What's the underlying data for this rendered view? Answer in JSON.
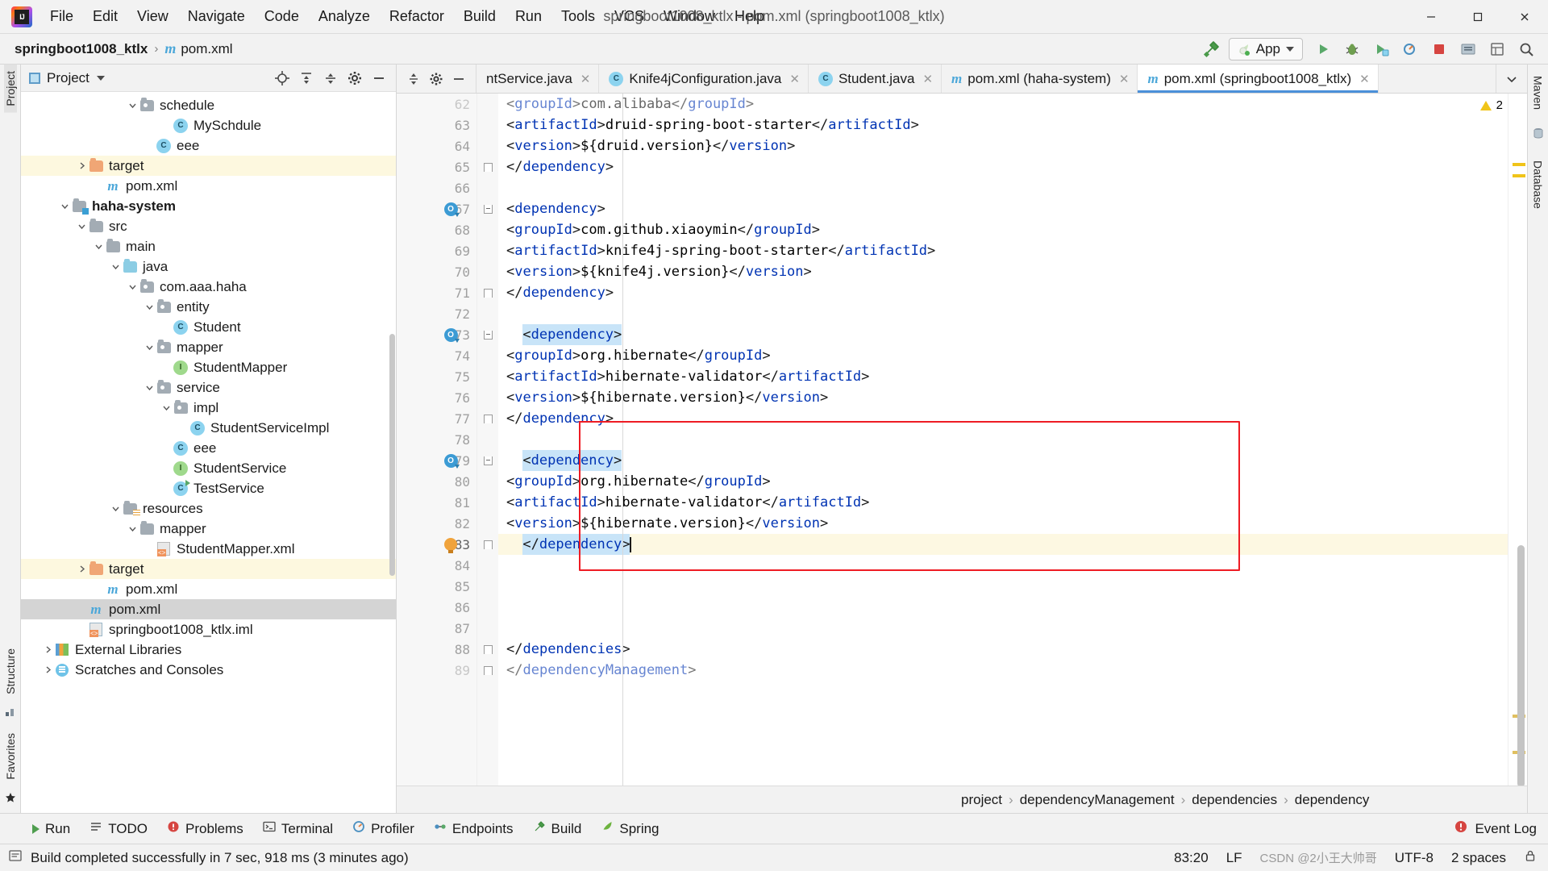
{
  "window": {
    "title": "springboot1008_ktlx - pom.xml (springboot1008_ktlx)",
    "minimize": "—",
    "maximize": "❐",
    "close": "✕",
    "logo_text": "IJ"
  },
  "menubar": {
    "items": [
      {
        "label": "File",
        "mnemonic": "F"
      },
      {
        "label": "Edit",
        "mnemonic": "E"
      },
      {
        "label": "View",
        "mnemonic": "V"
      },
      {
        "label": "Navigate",
        "mnemonic": "N"
      },
      {
        "label": "Code",
        "mnemonic": "C"
      },
      {
        "label": "Analyze",
        "mnemonic": "z"
      },
      {
        "label": "Refactor",
        "mnemonic": "R"
      },
      {
        "label": "Build",
        "mnemonic": "B"
      },
      {
        "label": "Run",
        "mnemonic": "u"
      },
      {
        "label": "Tools",
        "mnemonic": "T"
      },
      {
        "label": "VCS",
        "mnemonic": ""
      },
      {
        "label": "Window",
        "mnemonic": "W"
      },
      {
        "label": "Help",
        "mnemonic": "H"
      }
    ]
  },
  "navbar": {
    "project": "springboot1008_ktlx",
    "separator": "›",
    "file": "pom.xml",
    "run_config": "App",
    "icons": [
      "build-hammer-icon",
      "run-config-selector",
      "run-icon",
      "debug-icon",
      "run-coverage-icon",
      "profiler-icon",
      "stop-icon",
      "update-icon",
      "search-everywhere-icon"
    ]
  },
  "left_rail": {
    "top_label": "Project",
    "bottom_labels": [
      "Structure",
      "Favorites"
    ]
  },
  "right_rail": {
    "labels": [
      "Maven",
      "Database"
    ]
  },
  "project_panel": {
    "title": "Project",
    "actions": [
      "locate-icon",
      "expand-all-icon",
      "collapse-all-icon",
      "settings-gear-icon",
      "hide-icon"
    ],
    "tree": [
      {
        "label": "schedule",
        "indent": 6,
        "arrow": "down",
        "icon": "package-folder",
        "state": "normal"
      },
      {
        "label": "MySchdule",
        "indent": 8,
        "arrow": "none",
        "icon": "class",
        "state": "normal"
      },
      {
        "label": "eee",
        "indent": 7,
        "arrow": "none",
        "icon": "class",
        "state": "normal"
      },
      {
        "label": "target",
        "indent": 3,
        "arrow": "right",
        "icon": "folder-orange",
        "state": "highlight"
      },
      {
        "label": "pom.xml",
        "indent": 4,
        "arrow": "none",
        "icon": "maven",
        "state": "normal"
      },
      {
        "label": "haha-system",
        "indent": 2,
        "arrow": "down",
        "icon": "module-folder",
        "state": "bold"
      },
      {
        "label": "src",
        "indent": 3,
        "arrow": "down",
        "icon": "folder",
        "state": "normal"
      },
      {
        "label": "main",
        "indent": 4,
        "arrow": "down",
        "icon": "folder",
        "state": "normal"
      },
      {
        "label": "java",
        "indent": 5,
        "arrow": "down",
        "icon": "folder-blue",
        "state": "normal"
      },
      {
        "label": "com.aaa.haha",
        "indent": 6,
        "arrow": "down",
        "icon": "package-folder",
        "state": "normal"
      },
      {
        "label": "entity",
        "indent": 7,
        "arrow": "down",
        "icon": "package-folder",
        "state": "normal"
      },
      {
        "label": "Student",
        "indent": 8,
        "arrow": "none",
        "icon": "class",
        "state": "normal"
      },
      {
        "label": "mapper",
        "indent": 7,
        "arrow": "down",
        "icon": "package-folder",
        "state": "normal"
      },
      {
        "label": "StudentMapper",
        "indent": 8,
        "arrow": "none",
        "icon": "interface",
        "state": "normal"
      },
      {
        "label": "service",
        "indent": 7,
        "arrow": "down",
        "icon": "package-folder",
        "state": "normal"
      },
      {
        "label": "impl",
        "indent": 8,
        "arrow": "down",
        "icon": "package-folder",
        "state": "normal"
      },
      {
        "label": "StudentServiceImpl",
        "indent": 9,
        "arrow": "none",
        "icon": "class",
        "state": "normal"
      },
      {
        "label": "eee",
        "indent": 8,
        "arrow": "none",
        "icon": "class",
        "state": "normal"
      },
      {
        "label": "StudentService",
        "indent": 8,
        "arrow": "none",
        "icon": "interface",
        "state": "normal"
      },
      {
        "label": "TestService",
        "indent": 8,
        "arrow": "none",
        "icon": "class-runnable",
        "state": "normal"
      },
      {
        "label": "resources",
        "indent": 5,
        "arrow": "down",
        "icon": "resources-folder",
        "state": "normal"
      },
      {
        "label": "mapper",
        "indent": 6,
        "arrow": "down",
        "icon": "folder",
        "state": "normal"
      },
      {
        "label": "StudentMapper.xml",
        "indent": 7,
        "arrow": "none",
        "icon": "xml-file",
        "state": "normal"
      },
      {
        "label": "target",
        "indent": 3,
        "arrow": "right",
        "icon": "folder-orange",
        "state": "highlight"
      },
      {
        "label": "pom.xml",
        "indent": 4,
        "arrow": "none",
        "icon": "maven",
        "state": "normal"
      },
      {
        "label": "pom.xml",
        "indent": 3,
        "arrow": "none",
        "icon": "maven",
        "state": "selected"
      },
      {
        "label": "springboot1008_ktlx.iml",
        "indent": 3,
        "arrow": "none",
        "icon": "iml-file",
        "state": "normal"
      },
      {
        "label": "External Libraries",
        "indent": 1,
        "arrow": "right",
        "icon": "libraries",
        "state": "normal"
      },
      {
        "label": "Scratches and Consoles",
        "indent": 1,
        "arrow": "right",
        "icon": "scratches",
        "state": "normal"
      }
    ]
  },
  "editor": {
    "tabs": [
      {
        "label": "ntService.java",
        "icon": "none",
        "active": false,
        "closable": true
      },
      {
        "label": "Knife4jConfiguration.java",
        "icon": "class",
        "active": false,
        "closable": true
      },
      {
        "label": "Student.java",
        "icon": "class",
        "active": false,
        "closable": true
      },
      {
        "label": "pom.xml (haha-system)",
        "icon": "maven",
        "active": false,
        "closable": true
      },
      {
        "label": "pom.xml (springboot1008_ktlx)",
        "icon": "maven",
        "active": true,
        "closable": true
      }
    ],
    "tab_tools": [
      "sort-icon",
      "settings-gear-icon",
      "minimize-icon"
    ],
    "inspection_warning_count": "2",
    "lines": [
      {
        "n": "62",
        "text": "      <groupId>com.alibaba</groupId>",
        "clipped": true
      },
      {
        "n": "63",
        "text": "      <artifactId>druid-spring-boot-starter</artifactId>"
      },
      {
        "n": "64",
        "text": "      <version>${druid.version}</version>"
      },
      {
        "n": "65",
        "text": "  </dependency>"
      },
      {
        "n": "66",
        "text": ""
      },
      {
        "n": "67",
        "text": "  <dependency>",
        "gutter_icon": "override-icon"
      },
      {
        "n": "68",
        "text": "      <groupId>com.github.xiaoymin</groupId>"
      },
      {
        "n": "69",
        "text": "      <artifactId>knife4j-spring-boot-starter</artifactId>"
      },
      {
        "n": "70",
        "text": "      <version>${knife4j.version}</version>"
      },
      {
        "n": "71",
        "text": "  </dependency>"
      },
      {
        "n": "72",
        "text": ""
      },
      {
        "n": "73",
        "text": "  <dependency>",
        "gutter_icon": "override-icon",
        "highlight_tag": true
      },
      {
        "n": "74",
        "text": "      <groupId>org.hibernate</groupId>"
      },
      {
        "n": "75",
        "text": "      <artifactId>hibernate-validator</artifactId>"
      },
      {
        "n": "76",
        "text": "      <version>${hibernate.version}</version>"
      },
      {
        "n": "77",
        "text": "  </dependency>"
      },
      {
        "n": "78",
        "text": ""
      },
      {
        "n": "79",
        "text": "  <dependency>",
        "gutter_icon": "override-icon",
        "highlight_tag": true
      },
      {
        "n": "80",
        "text": "      <groupId>org.hibernate</groupId>"
      },
      {
        "n": "81",
        "text": "      <artifactId>hibernate-validator</artifactId>"
      },
      {
        "n": "82",
        "text": "      <version>${hibernate.version}</version>"
      },
      {
        "n": "83",
        "text": "  </dependency>",
        "gutter_icon": "bulb-icon",
        "current": true,
        "highlight_tag": true,
        "caret": true
      },
      {
        "n": "84",
        "text": ""
      },
      {
        "n": "85",
        "text": ""
      },
      {
        "n": "86",
        "text": ""
      },
      {
        "n": "87",
        "text": ""
      },
      {
        "n": "88",
        "text": "  </dependencies>"
      },
      {
        "n": "89",
        "text": " </dependencyManagement>",
        "clipped": true
      }
    ],
    "breadcrumb": [
      "project",
      "dependencyManagement",
      "dependencies",
      "dependency"
    ],
    "breadcrumb_sep": "›"
  },
  "tool_windows": {
    "items": [
      {
        "label": "Run",
        "icon": "run-icon"
      },
      {
        "label": "TODO",
        "icon": "todo-icon"
      },
      {
        "label": "Problems",
        "icon": "problems-icon"
      },
      {
        "label": "Terminal",
        "icon": "terminal-icon"
      },
      {
        "label": "Profiler",
        "icon": "profiler-icon"
      },
      {
        "label": "Endpoints",
        "icon": "endpoints-icon"
      },
      {
        "label": "Build",
        "icon": "build-icon"
      },
      {
        "label": "Spring",
        "icon": "spring-icon"
      }
    ],
    "event_log": "Event Log"
  },
  "statusbar": {
    "message": "Build completed successfully in 7 sec, 918 ms (3 minutes ago)",
    "position": "83:20",
    "line_separator": "LF",
    "encoding": "UTF-8",
    "indent": "2 spaces",
    "watermark": "CSDN @2小王大帅哥"
  },
  "colors": {
    "accent_blue": "#4a90d9",
    "tag_blue": "#0033b3",
    "highlight_red": "#ee1c24",
    "selection_cyan": "#c8e4f8",
    "current_line": "#fdf8e2",
    "folder_orange": "#f0a675"
  }
}
